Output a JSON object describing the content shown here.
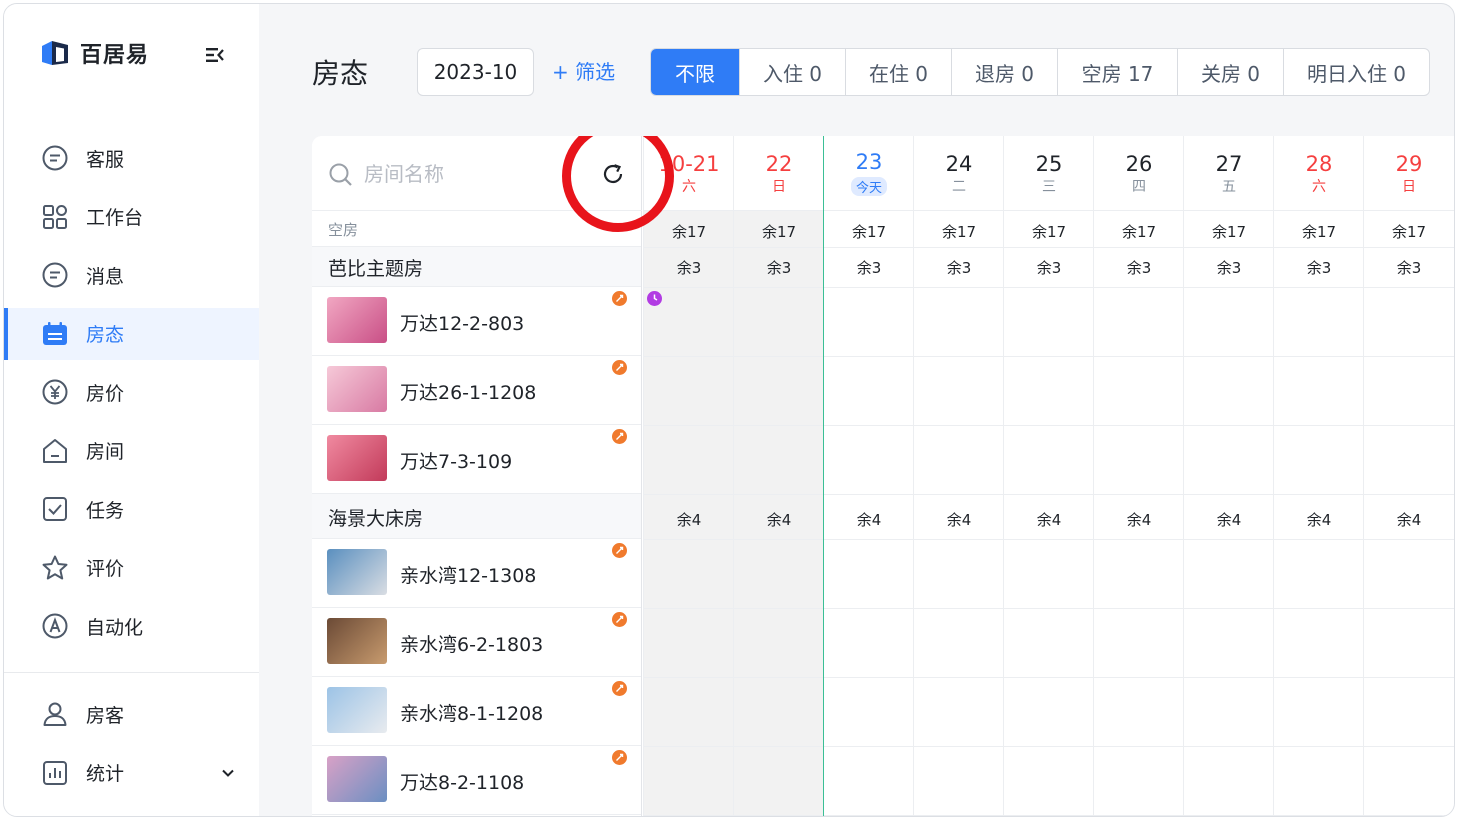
{
  "app": {
    "name": "百居易"
  },
  "sidebar": {
    "items": [
      {
        "label": "客服",
        "icon": "chat-icon"
      },
      {
        "label": "工作台",
        "icon": "grid-icon"
      },
      {
        "label": "消息",
        "icon": "message-icon"
      },
      {
        "label": "房态",
        "icon": "calendar-icon",
        "active": true
      },
      {
        "label": "房价",
        "icon": "yen-icon"
      },
      {
        "label": "房间",
        "icon": "house-icon"
      },
      {
        "label": "任务",
        "icon": "checkbox-icon"
      },
      {
        "label": "评价",
        "icon": "star-icon"
      },
      {
        "label": "自动化",
        "icon": "auto-icon"
      }
    ],
    "bottom_items": [
      {
        "label": "房客",
        "icon": "user-icon"
      },
      {
        "label": "统计",
        "icon": "stats-icon"
      }
    ]
  },
  "header": {
    "title": "房态",
    "month": "2023-10",
    "filter_label": "+ 筛选",
    "tabs": [
      {
        "label": "不限",
        "active": true
      },
      {
        "label": "入住 0"
      },
      {
        "label": "在住 0"
      },
      {
        "label": "退房 0"
      },
      {
        "label": "空房 17"
      },
      {
        "label": "关房 0"
      },
      {
        "label": "明日入住 0"
      }
    ]
  },
  "search": {
    "placeholder": "房间名称",
    "value": ""
  },
  "vacancy_label": "空房",
  "days": [
    {
      "num": "10-21",
      "week": "六",
      "color": "red",
      "vacant": "余17",
      "past": true
    },
    {
      "num": "22",
      "week": "日",
      "color": "red",
      "vacant": "余17",
      "past": true
    },
    {
      "num": "23",
      "week": "今天",
      "color": "blue",
      "vacant": "余17",
      "today": true
    },
    {
      "num": "24",
      "week": "二",
      "color": "normal",
      "vacant": "余17"
    },
    {
      "num": "25",
      "week": "三",
      "color": "normal",
      "vacant": "余17"
    },
    {
      "num": "26",
      "week": "四",
      "color": "normal",
      "vacant": "余17"
    },
    {
      "num": "27",
      "week": "五",
      "color": "normal",
      "vacant": "余17"
    },
    {
      "num": "28",
      "week": "六",
      "color": "red",
      "vacant": "余17"
    },
    {
      "num": "29",
      "week": "日",
      "color": "red",
      "vacant": "余17"
    }
  ],
  "groups": [
    {
      "name": "芭比主题房",
      "remaining": "余3",
      "rooms": [
        {
          "name": "万达12-2-803",
          "thumb": [
            "#f1a7c2",
            "#c94f86"
          ]
        },
        {
          "name": "万达26-1-1208",
          "thumb": [
            "#f6c9d8",
            "#d87aa3"
          ]
        },
        {
          "name": "万达7-3-109",
          "thumb": [
            "#f08aa0",
            "#c23a5a"
          ]
        }
      ]
    },
    {
      "name": "海景大床房",
      "remaining": "余4",
      "rooms": [
        {
          "name": "亲水湾12-1308",
          "thumb": [
            "#5a8fbf",
            "#d9dde3"
          ]
        },
        {
          "name": "亲水湾6-2-1803",
          "thumb": [
            "#6b4a36",
            "#c89b6e"
          ]
        },
        {
          "name": "亲水湾8-1-1208",
          "thumb": [
            "#9cc3e6",
            "#e8ebef"
          ]
        },
        {
          "name": "万达8-2-1108",
          "thumb": [
            "#d8a1c6",
            "#6b8fc2"
          ]
        }
      ]
    }
  ],
  "colors": {
    "accent": "#2f7cf6",
    "weekend": "#f53f3f",
    "today_line": "#3bbf96",
    "badge": "#f07a2d",
    "highlight_ring": "#e8141b"
  }
}
